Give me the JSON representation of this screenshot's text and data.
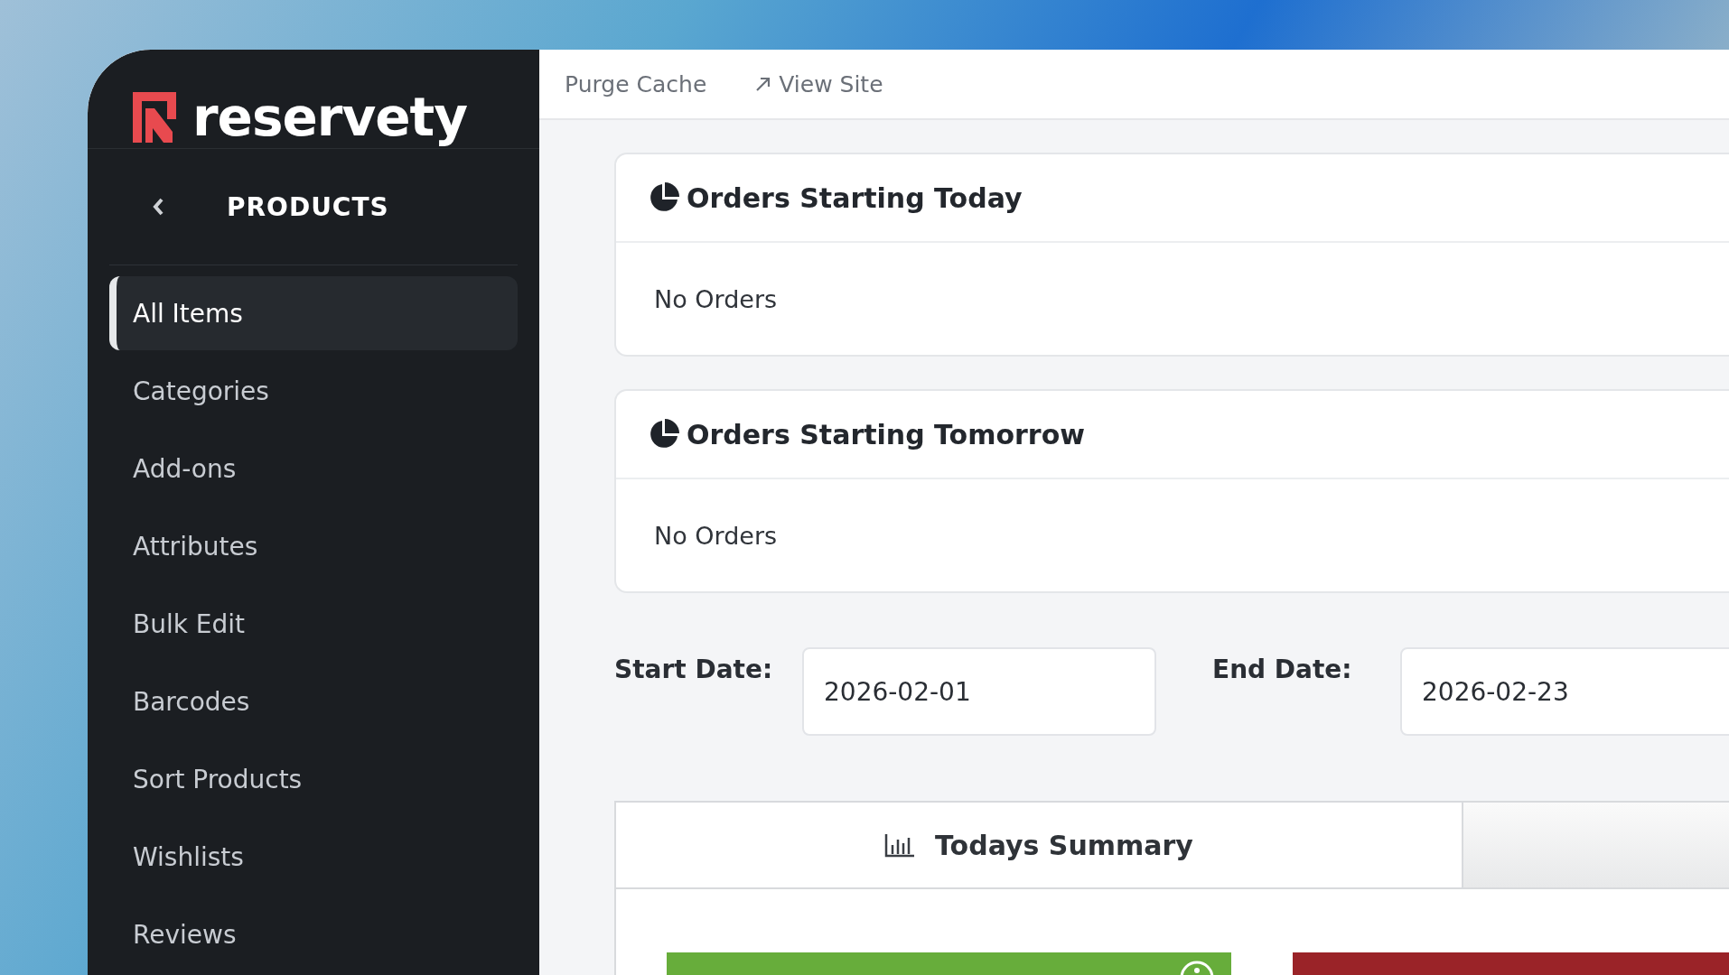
{
  "logo": {
    "text": "reservety"
  },
  "top_bar": {
    "links": [
      {
        "label": "Purge Cache",
        "kind": "plain"
      },
      {
        "label": "View Site",
        "kind": "external"
      }
    ]
  },
  "sidebar": {
    "header": "PRODUCTS",
    "items": [
      {
        "label": "All Items",
        "selected": true
      },
      {
        "label": "Categories",
        "selected": false
      },
      {
        "label": "Add-ons",
        "selected": false
      },
      {
        "label": "Attributes",
        "selected": false
      },
      {
        "label": "Bulk Edit",
        "selected": false
      },
      {
        "label": "Barcodes",
        "selected": false
      },
      {
        "label": "Sort Products",
        "selected": false
      },
      {
        "label": "Wishlists",
        "selected": false
      },
      {
        "label": "Reviews",
        "selected": false
      }
    ]
  },
  "order_cards": [
    {
      "title": "Orders Starting Today",
      "message": "No Orders"
    },
    {
      "title": "Orders Starting Tomorrow",
      "message": "No Orders"
    }
  ],
  "date_filter": {
    "start": {
      "label": "Start Date:",
      "value": "2026-02-01"
    },
    "end": {
      "label": "End Date:",
      "value": "2026-02-23"
    }
  },
  "summary_tabs": [
    {
      "label": "Todays Summary",
      "selected": true
    },
    {
      "selected": false
    }
  ],
  "summary_boxes": [
    {
      "color": "#67ad3b"
    },
    {
      "color": "#9a2328"
    }
  ]
}
